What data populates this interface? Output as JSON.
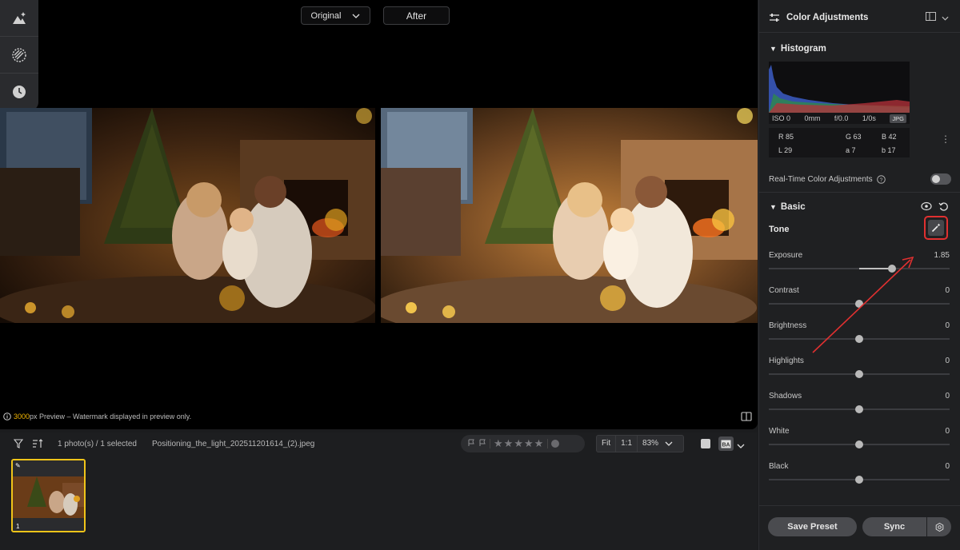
{
  "viewer": {
    "compare_select": "Original",
    "after_label": "After",
    "preview_px": "3000",
    "preview_note": "px Preview – Watermark displayed in preview only."
  },
  "filmstrip": {
    "photo_count": "1 photo(s) / 1 selected",
    "filename": "Positioning_the_light_202511201614_(2).jpeg",
    "fit_label": "Fit",
    "one_to_one": "1:1",
    "zoom": "83%",
    "thumb_index": "1",
    "rating_stars": 0
  },
  "panel": {
    "title": "Color Adjustments",
    "histogram_title": "Histogram",
    "exif": {
      "iso": "ISO 0",
      "focal": "0mm",
      "aperture": "f/0.0",
      "shutter": "1/0s",
      "format": "JPG"
    },
    "color_values": {
      "r": "R 85",
      "g": "G 63",
      "b": "B 42",
      "l": "L 29",
      "a": "a 7",
      "b2": "b 17"
    },
    "realtime_label": "Real-Time Color Adjustments",
    "basic_title": "Basic",
    "tone_label": "Tone",
    "sliders": [
      {
        "label": "Exposure",
        "value": "1.85",
        "position": 0.68
      },
      {
        "label": "Contrast",
        "value": "0",
        "position": 0.5
      },
      {
        "label": "Brightness",
        "value": "0",
        "position": 0.5
      },
      {
        "label": "Highlights",
        "value": "0",
        "position": 0.5
      },
      {
        "label": "Shadows",
        "value": "0",
        "position": 0.5
      },
      {
        "label": "White",
        "value": "0",
        "position": 0.5
      },
      {
        "label": "Black",
        "value": "0",
        "position": 0.5
      }
    ],
    "save_preset": "Save Preset",
    "sync": "Sync"
  },
  "colors": {
    "accent_yellow": "#f0c419",
    "highlight_red": "#e03030"
  }
}
